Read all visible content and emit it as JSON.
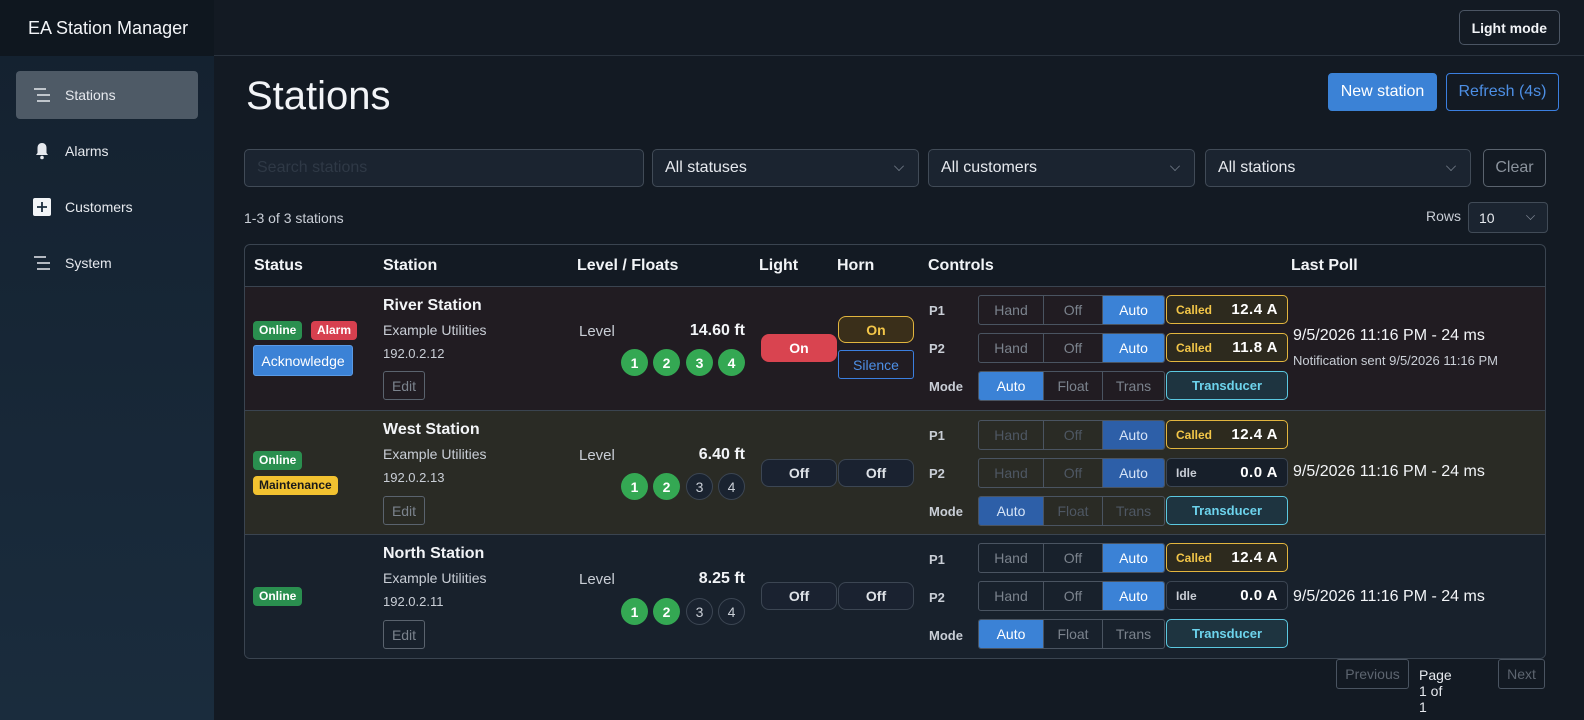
{
  "app": {
    "title": "EA Station Manager"
  },
  "sidebar": {
    "items": [
      {
        "label": "Stations",
        "icon": "menu-lines-icon",
        "active": true
      },
      {
        "label": "Alarms",
        "icon": "bell-icon"
      },
      {
        "label": "Customers",
        "icon": "plus-box-icon"
      },
      {
        "label": "System",
        "icon": "menu-lines-icon"
      }
    ]
  },
  "topbar": {
    "light_mode_label": "Light mode"
  },
  "page": {
    "title": "Stations",
    "new_station_label": "New station",
    "refresh_label": "Refresh (4s)"
  },
  "filters": {
    "search_value": "",
    "search_placeholder": "Search stations",
    "status": "All statuses",
    "customer": "All customers",
    "station": "All stations",
    "clear_label": "Clear"
  },
  "list": {
    "count_text": "1-3 of 3 stations",
    "rows_label": "Rows",
    "rows_value": "10"
  },
  "table": {
    "headers": {
      "status": "Status",
      "station": "Station",
      "level": "Level / Floats",
      "light": "Light",
      "horn": "Horn",
      "controls": "Controls",
      "last_poll": "Last Poll"
    },
    "labels": {
      "level": "Level",
      "p1": "P1",
      "p2": "P2",
      "mode": "Mode",
      "hand": "Hand",
      "off": "Off",
      "auto": "Auto",
      "float": "Float",
      "trans": "Trans",
      "transducer": "Transducer",
      "edit": "Edit",
      "acknowledge": "Acknowledge"
    },
    "rows": [
      {
        "name": "River Station",
        "customer": "Example Utilities",
        "ip": "192.0.2.12",
        "badges": [
          "Online",
          "Alarm"
        ],
        "level": "14.60 ft",
        "floats": [
          "1",
          "2",
          "3",
          "4"
        ],
        "floats_on": 4,
        "light": "On",
        "horn": "On",
        "silence": "Silence",
        "p1_state": "Called",
        "p1_amps": "12.4 A",
        "p2_state": "Called",
        "p2_amps": "11.8 A",
        "poll": "9/5/2026 11:16 PM - 24 ms",
        "notification": "Notification sent 9/5/2026 11:16 PM"
      },
      {
        "name": "West Station",
        "customer": "Example Utilities",
        "ip": "192.0.2.13",
        "badges": [
          "Online",
          "Maintenance"
        ],
        "level": "6.40 ft",
        "floats": [
          "1",
          "2",
          "3",
          "4"
        ],
        "floats_on": 2,
        "light": "Off",
        "horn": "Off",
        "p1_state": "Called",
        "p1_amps": "12.4 A",
        "p2_state": "Idle",
        "p2_amps": "0.0 A",
        "poll": "9/5/2026 11:16 PM - 24 ms"
      },
      {
        "name": "North Station",
        "customer": "Example Utilities",
        "ip": "192.0.2.11",
        "badges": [
          "Online"
        ],
        "level": "8.25 ft",
        "floats": [
          "1",
          "2",
          "3",
          "4"
        ],
        "floats_on": 2,
        "light": "Off",
        "horn": "Off",
        "p1_state": "Called",
        "p1_amps": "12.4 A",
        "p2_state": "Idle",
        "p2_amps": "0.0 A",
        "poll": "9/5/2026 11:16 PM - 24 ms"
      }
    ]
  },
  "pager": {
    "previous": "Previous",
    "page_text": "Page 1 of 1",
    "next": "Next"
  },
  "colors": {
    "accent": "#3b82d6",
    "online": "#2a8f4f",
    "alarm": "#d7404f",
    "maintenance": "#f2c230",
    "transducer": "#5bc8e0"
  }
}
